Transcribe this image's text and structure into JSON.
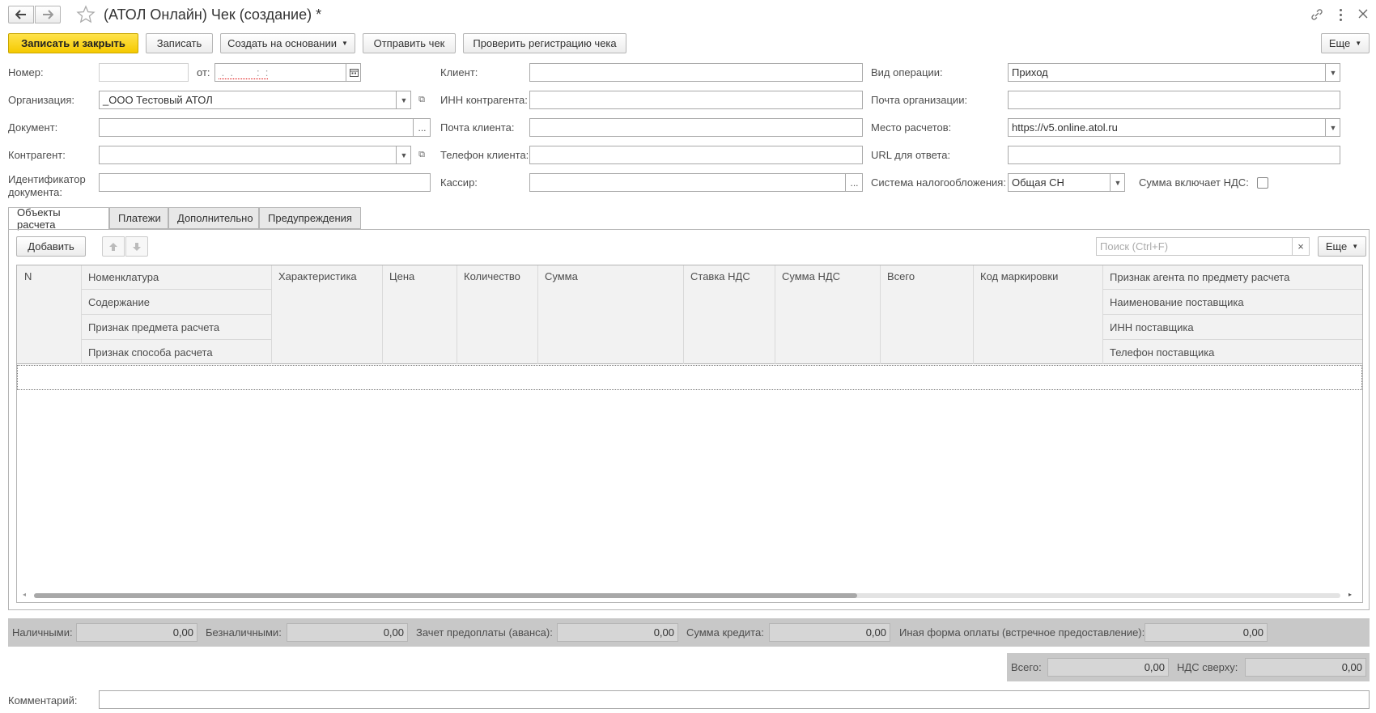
{
  "window": {
    "title": "(АТОЛ Онлайн) Чек (создание) *"
  },
  "toolbar": {
    "save_close": "Записать и закрыть",
    "save": "Записать",
    "create_based_on": "Создать на основании",
    "send_receipt": "Отправить чек",
    "check_registration": "Проверить регистрацию чека",
    "more": "Еще"
  },
  "header": {
    "number_label": "Номер:",
    "number_value": "",
    "date_label": "от:",
    "date_value": " .  .        :  :",
    "organization_label": "Организация:",
    "organization_value": "_ООО Тестовый АТОЛ",
    "document_label": "Документ:",
    "document_value": "",
    "counterparty_label": "Контрагент:",
    "counterparty_value": "",
    "doc_id_label_1": "Идентификатор",
    "doc_id_label_2": "документа:",
    "doc_id_value": "",
    "client_label": "Клиент:",
    "client_value": "",
    "inn_label": "ИНН контрагента:",
    "inn_value": "",
    "client_email_label": "Почта клиента:",
    "client_email_value": "",
    "client_phone_label": "Телефон клиента:",
    "client_phone_value": "",
    "cashier_label": "Кассир:",
    "cashier_value": "",
    "operation_label": "Вид операции:",
    "operation_value": "Приход",
    "org_email_label": "Почта организации:",
    "org_email_value": "",
    "payment_place_label": "Место расчетов:",
    "payment_place_value": "https://v5.online.atol.ru",
    "callback_url_label": "URL для ответа:",
    "callback_url_value": "",
    "tax_system_label": "Система налогообложения:",
    "tax_system_value": "Общая СН",
    "vat_included_label": "Сумма включает НДС:",
    "vat_included_checked": false
  },
  "tabs": [
    {
      "label": "Объекты расчета",
      "active": true
    },
    {
      "label": "Платежи",
      "active": false
    },
    {
      "label": "Дополнительно",
      "active": false
    },
    {
      "label": "Предупреждения",
      "active": false
    }
  ],
  "table_toolbar": {
    "add": "Добавить",
    "search_placeholder": "Поиск (Ctrl+F)",
    "clear": "×",
    "more": "Еще"
  },
  "table": {
    "columns": {
      "n": "N",
      "nomenclature": "Номенклатура",
      "content": "Содержание",
      "subject_sign": "Признак предмета расчета",
      "method_sign": "Признак способа расчета",
      "characteristic": "Характеристика",
      "price": "Цена",
      "quantity": "Количество",
      "sum": "Сумма",
      "vat_rate": "Ставка НДС",
      "vat_sum": "Сумма НДС",
      "total": "Всего",
      "marking_code": "Код маркировки",
      "agent_sign": "Признак агента по предмету расчета",
      "supplier_name": "Наименование поставщика",
      "supplier_inn": "ИНН поставщика",
      "supplier_phone": "Телефон поставщика"
    },
    "rows": []
  },
  "payments": {
    "cash_label": "Наличными:",
    "cash_value": "0,00",
    "cashless_label": "Безналичными:",
    "cashless_value": "0,00",
    "prepay_label": "Зачет предоплаты (аванса):",
    "prepay_value": "0,00",
    "credit_label": "Сумма кредита:",
    "credit_value": "0,00",
    "other_label": "Иная форма оплаты (встречное предоставление):",
    "other_value": "0,00"
  },
  "totals": {
    "total_label": "Всего:",
    "total_value": "0,00",
    "vat_label": "НДС сверху:",
    "vat_value": "0,00"
  },
  "comment": {
    "label": "Комментарий:",
    "value": ""
  }
}
